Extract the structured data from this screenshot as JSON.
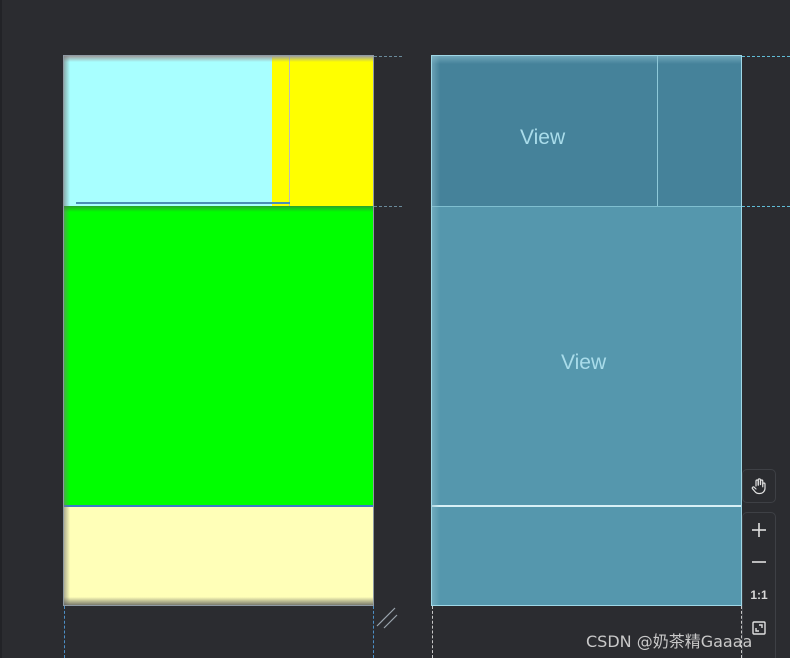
{
  "design_surface": {
    "blocks": [
      {
        "name": "cyan-block",
        "color": "#a8ffff"
      },
      {
        "name": "yellow-block",
        "color": "#ffff00"
      },
      {
        "name": "green-block",
        "color": "#00ff00"
      },
      {
        "name": "cream-block",
        "color": "#ffffb8"
      }
    ]
  },
  "blueprint_surface": {
    "label_top": "View",
    "label_middle": "View",
    "colors": {
      "top": "#45829a",
      "middle": "#5597ad",
      "bottom": "#5597ad"
    }
  },
  "toolbar": {
    "pan_icon": "hand-icon",
    "zoom_in_icon": "plus-icon",
    "zoom_out_icon": "minus-icon",
    "actual_size_label": "1:1",
    "fit_icon": "fit-screen-icon"
  },
  "watermark": "CSDN @奶茶精Gaaaa"
}
